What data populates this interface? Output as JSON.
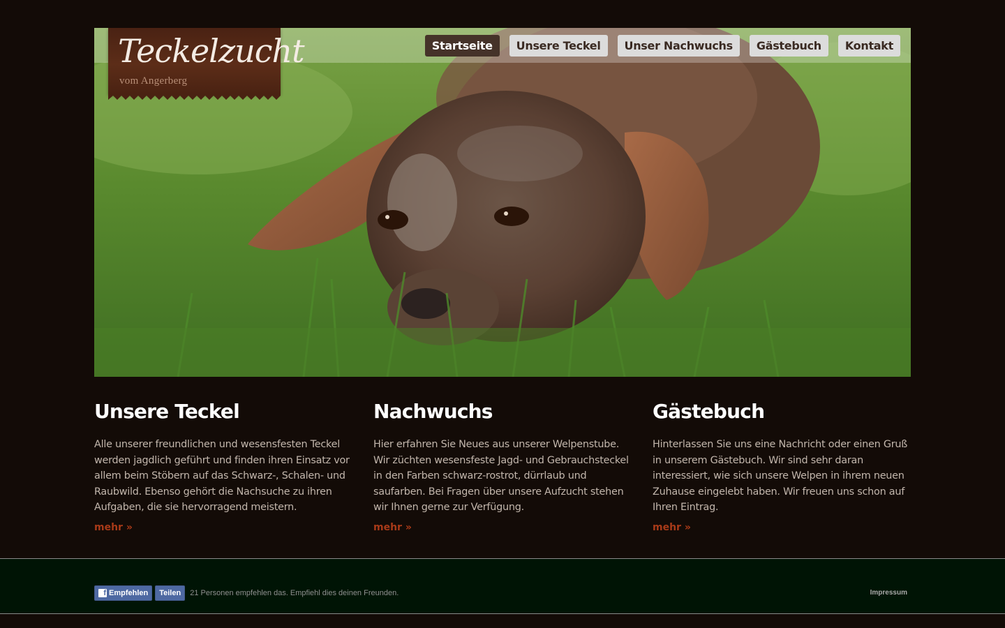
{
  "logo": {
    "title": "Teckelzucht",
    "subtitle": "vom Angerberg"
  },
  "nav": {
    "items": [
      {
        "label": "Startseite"
      },
      {
        "label": "Unsere Teckel"
      },
      {
        "label": "Unser Nachwuchs"
      },
      {
        "label": "Gästebuch"
      },
      {
        "label": "Kontakt"
      }
    ],
    "active": "Startseite"
  },
  "hero": {
    "image": "dachshund lying in grass"
  },
  "columns": [
    {
      "title": "Unsere Teckel",
      "text": "Alle unserer freundlichen und wesensfesten Teckel werden jagdlich geführt und finden ihren Einsatz vor allem beim Stöbern auf das Schwarz-, Schalen- und Raubwild. Ebenso gehört die Nachsuche zu ihren Aufgaben, die sie hervorragend meistern.",
      "more": "mehr »"
    },
    {
      "title": "Nachwuchs",
      "text": "Hier erfahren Sie Neues aus unserer Welpenstube. Wir züchten wesensfeste Jagd- und Gebrauchsteckel in den Farben schwarz-rostrot, dürrlaub und saufarben. Bei Fragen über unsere Aufzucht stehen wir Ihnen gerne zur Verfügung.",
      "more": "mehr »"
    },
    {
      "title": "Gästebuch",
      "text": "Hinterlassen Sie uns eine Nachricht oder einen Gruß in unserem Gästebuch. Wir sind sehr daran interessiert, wie sich unsere Welpen in ihrem neuen Zuhause eingelebt haben. Wir freuen uns schon auf Ihren Eintrag.",
      "more": "mehr »"
    }
  ],
  "footer": {
    "fb_like": "Empfehlen",
    "fb_share": "Teilen",
    "fb_text": "21 Personen empfehlen das. Empfiehl dies deinen Freunden.",
    "impressum": "Impressum"
  },
  "colors": {
    "background": "#130b07",
    "accent_link": "#a83a18",
    "footer_bg": "#001405",
    "nav_active": "#453229"
  }
}
